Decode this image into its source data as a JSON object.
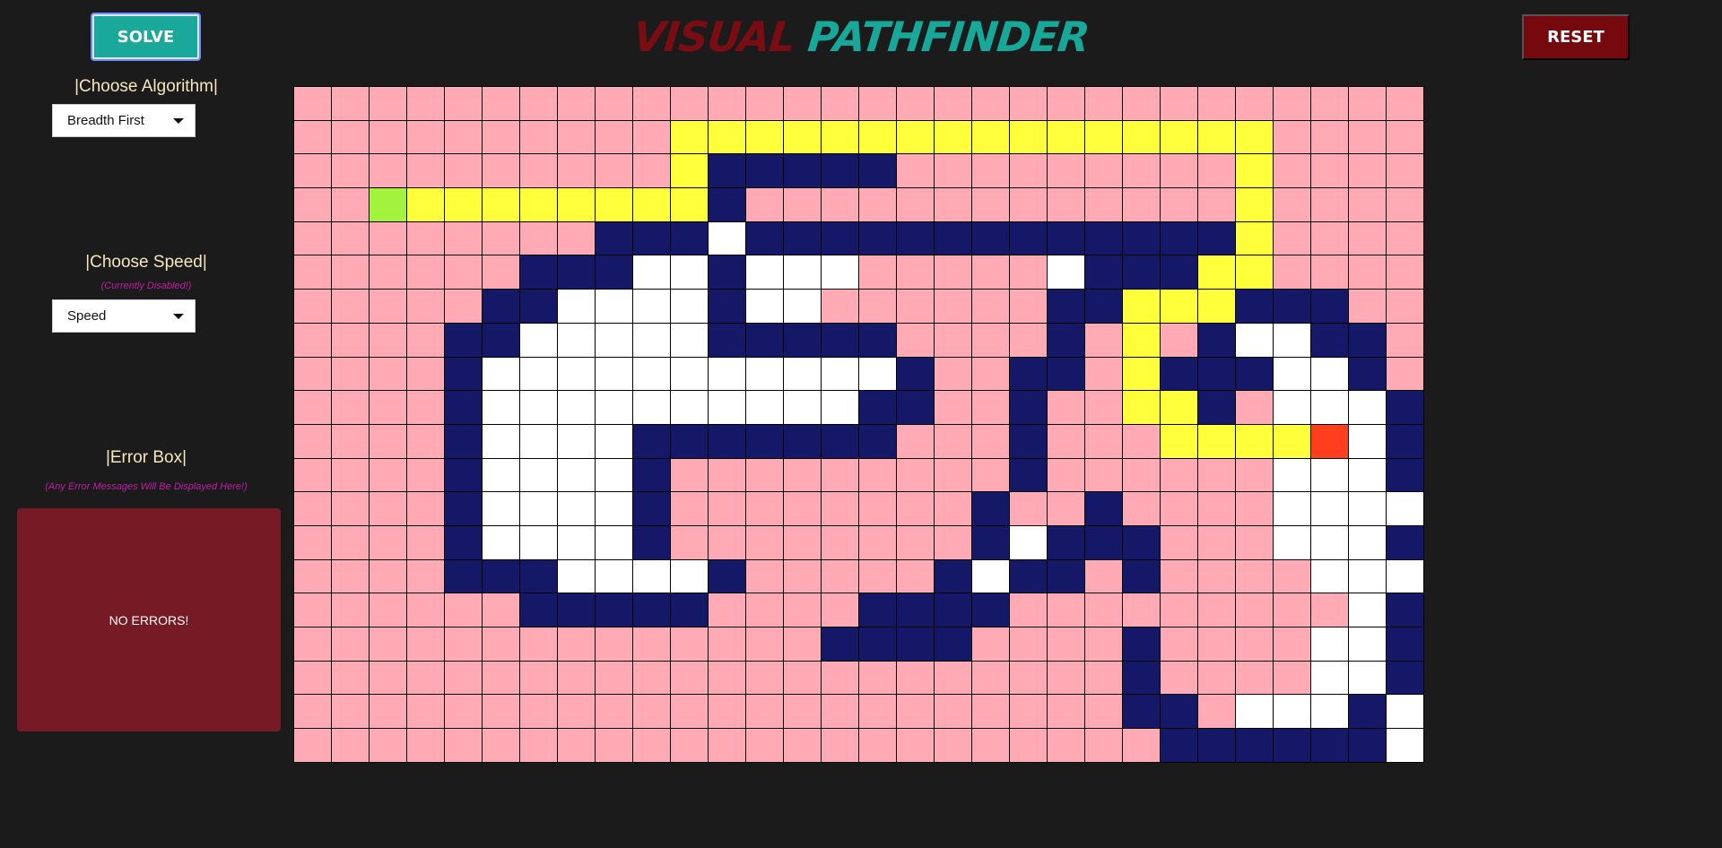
{
  "header": {
    "solve_label": "SOLVE",
    "reset_label": "RESET",
    "title_part1": "VISUAL",
    "title_part2": "PATHFINDER"
  },
  "sidebar": {
    "algorithm_label": "|Choose Algorithm|",
    "algorithm_selected": "Breadth First",
    "speed_label": "|Choose Speed|",
    "speed_note": "(Currently Disabled!)",
    "speed_selected": "Speed",
    "error_label": "|Error Box|",
    "error_note": "(Any Error Messages Will Be Displayed Here!)",
    "error_message": "NO ERRORS!"
  },
  "colors": {
    "background": "#1b1b1b",
    "unvisited": "#ffaab4",
    "wall": "#151866",
    "visited": "#ffffff",
    "path": "#ffff3c",
    "start": "#a3f23d",
    "end": "#fe3e1c",
    "solve_button": "#1aa89a",
    "reset_button": "#76090d",
    "error_box": "#761a26"
  },
  "grid": {
    "rows": 20,
    "cols": 30,
    "legend": {
      "P": "unvisited",
      "W": "wall",
      "V": "visited",
      "Y": "path",
      "S": "start",
      "E": "end"
    },
    "cells": [
      "PPPPPPPPPPPPPPPPPPPPPPPPPPPPPP",
      "PPPPPPPPPPYYYYYYYYYYYYYYYYPPPP",
      "PPPPPPPPPPYWWWWWPPPPPPPPPYPPPP",
      "PPSYYYYYYYYWPPPPPPPPPPPPPYPPPP",
      "PPPPPPPPWWWVWWWWWWWWWWWWWYPPPP",
      "PPPPPPWWWVVWVVVPPPPPVWWWYYPPPP",
      "PPPPPWWVVVVWVVPPPPPPWWYYYWWWPP",
      "PPPPWWVVVVVWWWWWPPPPWPYPWVVWWP",
      "PPPPWVVVVVVVVVVVWPPWWPYWWWVVWP",
      "PPPPWVVVVVVVVVVWWPPWPPYYWPVVVW",
      "PPPPWVVVVWWWWWWWPPPWPPPYYYYEVW",
      "PPPPWVVVVWPPPPPPPPPWPPPPPPVVVW",
      "PPPPWVVVVWPPPPPPPPWPPWPPPPVVVV",
      "PPPPWVVVVWPPPPPPPPWVWWWPPPVVVW",
      "PPPPWWWVVVVWPPPPPWVWWPWPPPPVVV",
      "PPPPPPWWWWWPPPPWWWWPPPPPPPPPVW",
      "PPPPPPPPPPPPPPWWWWPPPPWPPPPVVW",
      "PPPPPPPPPPPPPPPPPPPPPPWPPPPVVWV",
      "PPPPPPPPPPPPPPPPPPPPPPWWPVVVWV",
      "PPPPPPPPPPPPPPPPPPPPPPPWWWWWWV"
    ]
  }
}
